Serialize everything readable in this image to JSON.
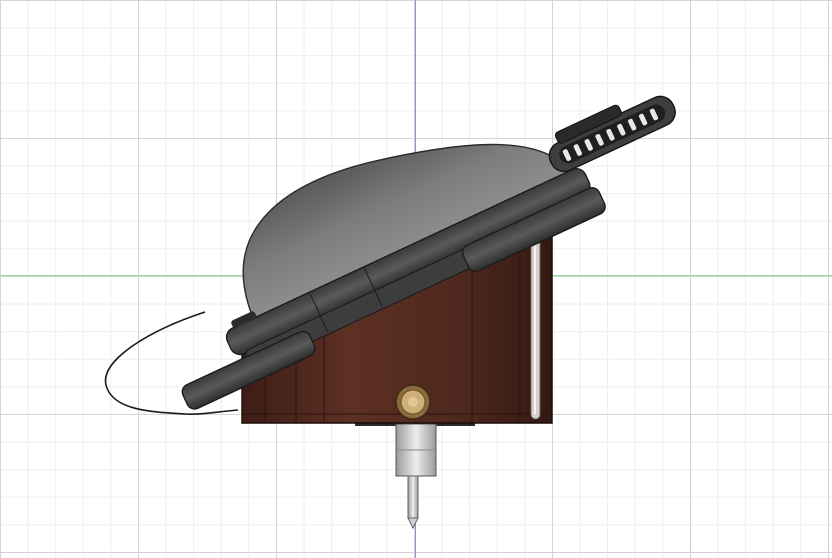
{
  "canvas": {
    "background": "#ffffff",
    "grid_major_color": "#d4d4d4",
    "grid_minor_color": "#eeeeee",
    "axis_vertical_color": "#8f8fe0",
    "axis_horizontal_color": "#8ee08e"
  },
  "model": {
    "body_color": "#5a2e22",
    "shell_color": "#4a4a4a",
    "dome_color": "#777777",
    "knob_color": "#c8a870",
    "probe_color": "#d8d8d8"
  }
}
